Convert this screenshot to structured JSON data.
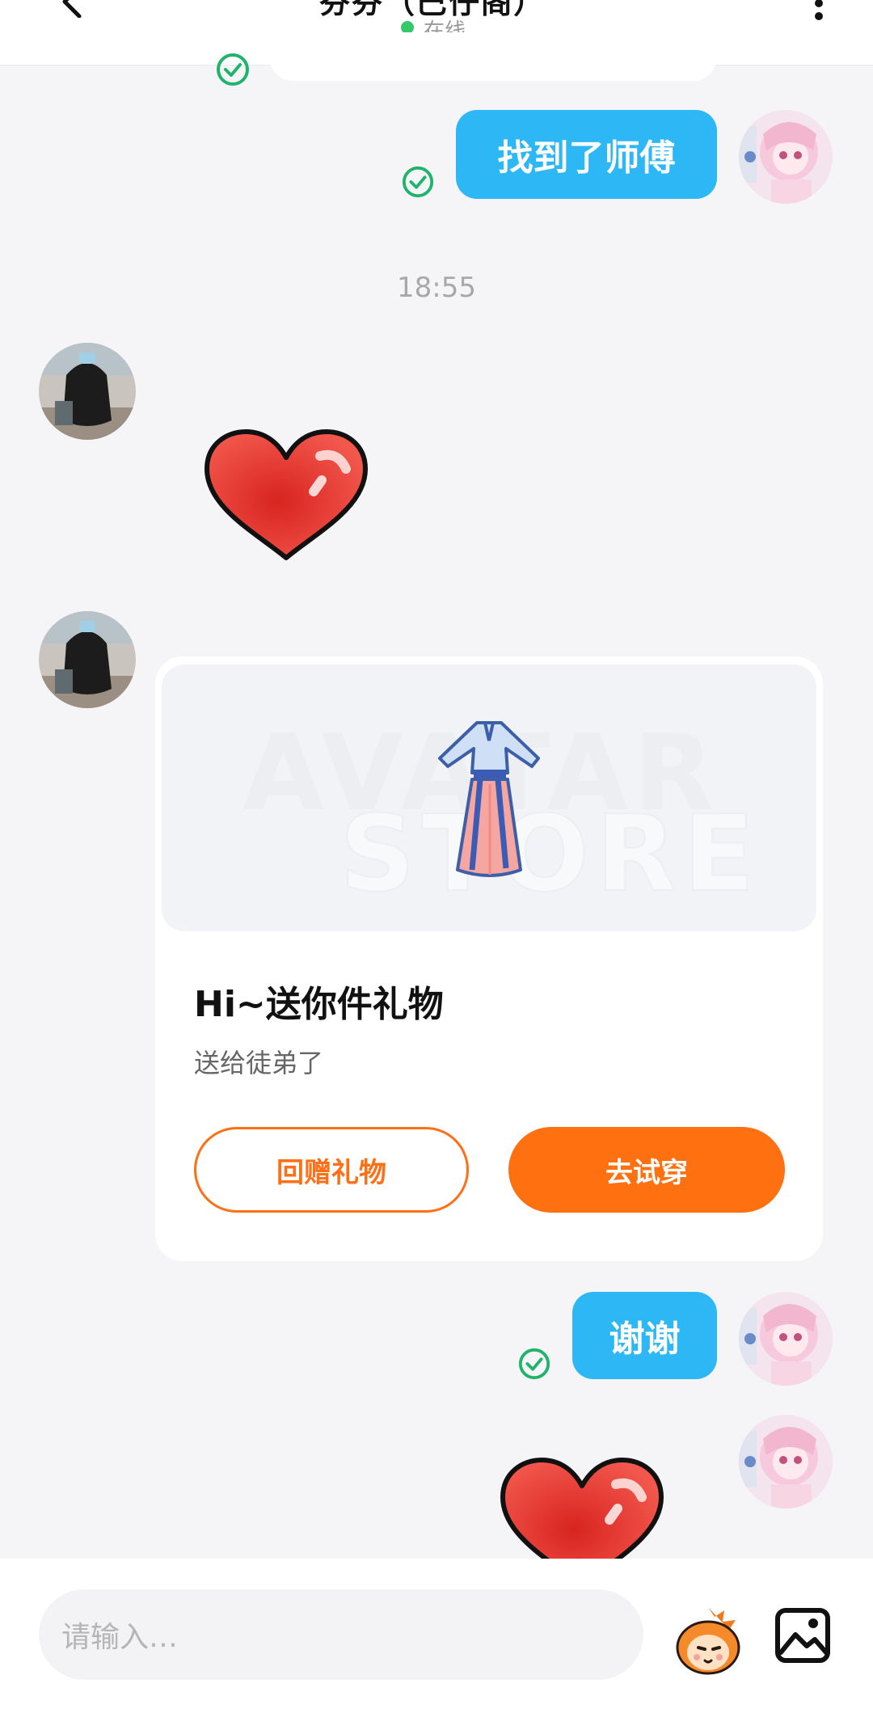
{
  "header": {
    "title": "芬芬（巴仔阁）",
    "status": "在线"
  },
  "messages": {
    "msg1_text": "找到了师傅",
    "time": "18:55",
    "gift_card": {
      "watermark_line1": "AVATAR",
      "watermark_line2": "STORE",
      "title": "Hi~送你件礼物",
      "subtitle": "送给徒弟了",
      "button_return": "回赠礼物",
      "button_try": "去试穿"
    },
    "msg2_text": "谢谢"
  },
  "input": {
    "placeholder": "请输入…"
  },
  "icons": {
    "back": "chevron-left-icon",
    "more": "more-vertical-icon",
    "read": "check-circle-icon",
    "heart": "heart-sticker-icon",
    "emoji": "mascot-emoji-icon",
    "image": "image-icon"
  },
  "colors": {
    "accent_blue": "#2db7f5",
    "accent_orange": "#ff7011",
    "online_green": "#33c86a",
    "read_green": "#1fb36b"
  }
}
